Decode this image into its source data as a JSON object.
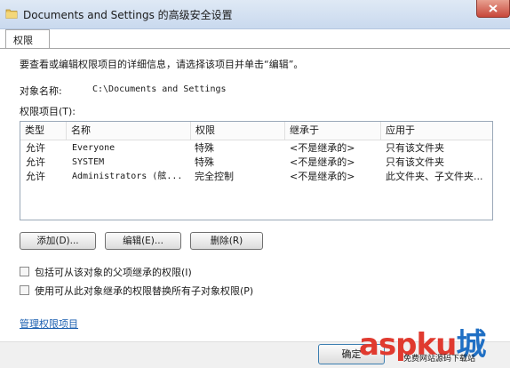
{
  "window": {
    "title": "Documents and Settings 的高级安全设置"
  },
  "tabs": [
    {
      "label": "权限",
      "active": true
    }
  ],
  "main": {
    "instruction": "要查看或编辑权限项目的详细信息，请选择该项目并单击“编辑”。",
    "object_label": "对象名称:",
    "object_value": "C:\\Documents and Settings",
    "entries_label": "权限项目(T):"
  },
  "permissions_table": {
    "columns": [
      "类型",
      "名称",
      "权限",
      "继承于",
      "应用于"
    ],
    "rows": [
      {
        "type": "允许",
        "name": "Everyone",
        "permission": "特殊",
        "inherited_from": "<不是继承的>",
        "applies_to": "只有该文件夹"
      },
      {
        "type": "允许",
        "name": "SYSTEM",
        "permission": "特殊",
        "inherited_from": "<不是继承的>",
        "applies_to": "只有该文件夹"
      },
      {
        "type": "允许",
        "name": "Administrators (舷...",
        "permission": "完全控制",
        "inherited_from": "<不是继承的>",
        "applies_to": "此文件夹、子文件夹..."
      }
    ]
  },
  "buttons": {
    "add": "添加(D)...",
    "edit": "编辑(E)...",
    "delete": "删除(R)",
    "ok": "确定"
  },
  "checkboxes": [
    {
      "label": "包括可从该对象的父项继承的权限(I)",
      "checked": false
    },
    {
      "label": "使用可从此对象继承的权限替换所有子对象权限(P)",
      "checked": false
    }
  ],
  "links": {
    "manage_permissions": "管理权限项目"
  },
  "watermark": {
    "brand": "aspku",
    "suffix": "城",
    "tagline": "免费网站源码下载站"
  },
  "colors": {
    "titlebar": "#c9d9ee",
    "link": "#1b5fb0",
    "close_button": "#c7473a",
    "watermark_red": "#e03a2f",
    "watermark_blue": "#1f6fc4"
  }
}
